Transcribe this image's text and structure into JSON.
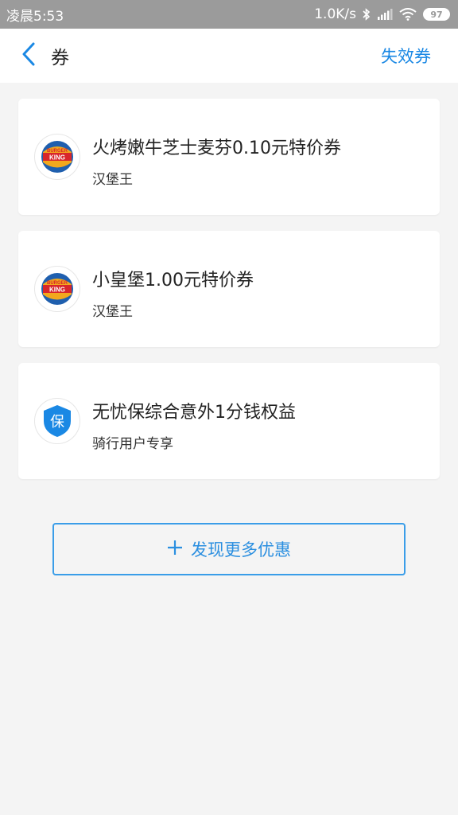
{
  "status_bar": {
    "time": "凌晨5:53",
    "net_speed": "1.0K/s",
    "battery": "97"
  },
  "header": {
    "title": "券",
    "right_action": "失效券"
  },
  "coupons": [
    {
      "title": "火烤嫩牛芝士麦芬0.10元特价券",
      "merchant": "汉堡王",
      "logo": "burger-king-logo"
    },
    {
      "title": "小皇堡1.00元特价券",
      "merchant": "汉堡王",
      "logo": "burger-king-logo"
    },
    {
      "title": "无忧保综合意外1分钱权益",
      "merchant": "骑行用户专享",
      "logo": "shield-bao-logo",
      "logo_text": "保"
    }
  ],
  "more_button": {
    "label": "发现更多优惠",
    "icon": "plus-icon"
  },
  "colors": {
    "accent": "#1a88e4",
    "status_bar": "#9b9b9b",
    "background": "#f4f4f4"
  }
}
